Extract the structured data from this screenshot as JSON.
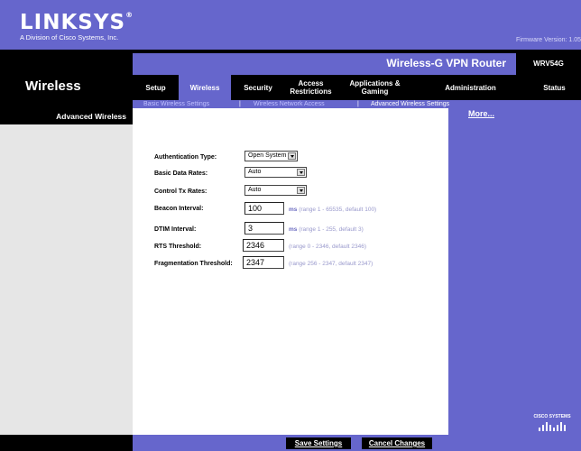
{
  "header": {
    "logo": "LINKSYS",
    "logo_mark": "®",
    "logo_subtitle": "A Division of Cisco Systems, Inc.",
    "firmware": "Firmware Version: 1.05"
  },
  "product": {
    "name": "Wireless-G VPN Router",
    "model": "WRV54G"
  },
  "section_title": "Wireless",
  "tabs": [
    {
      "label": "Setup"
    },
    {
      "label": "Wireless",
      "active": true
    },
    {
      "label": "Security"
    },
    {
      "label": "Access Restrictions"
    },
    {
      "label": "Applications & Gaming"
    },
    {
      "label": "Administration"
    },
    {
      "label": "Status"
    }
  ],
  "subnav": {
    "items": [
      "Basic Wireless Settings",
      "Wireless Network Access",
      "Advanced Wireless Settings"
    ],
    "active": "Advanced Wireless Settings",
    "separator": "|"
  },
  "left_heading": "Advanced Wireless",
  "right": {
    "more_link": "More...",
    "cisco_logo": "CISCO SYSTEMS"
  },
  "form": {
    "auth_type": {
      "label": "Authentication Type:",
      "value": "Open System"
    },
    "basic_rates": {
      "label": "Basic Data Rates:",
      "value": "Auto"
    },
    "control_tx": {
      "label": "Control Tx Rates:",
      "value": "Auto"
    },
    "beacon": {
      "label": "Beacon Interval:",
      "value": "100",
      "unit": "ms",
      "hint": "(range 1 - 65535, default 100)"
    },
    "dtim": {
      "label": "DTIM Interval:",
      "value": "3",
      "unit": "ms",
      "hint": "(range 1 - 255, default 3)"
    },
    "rts": {
      "label": "RTS Threshold:",
      "value": "2346",
      "hint": "(range 0 - 2346, default 2346)"
    },
    "frag": {
      "label": "Fragmentation Threshold:",
      "value": "2347",
      "hint": "(range 256 - 2347, default 2347)"
    }
  },
  "buttons": {
    "save": "Save Settings",
    "cancel": "Cancel Changes"
  },
  "colors": {
    "brand": "#6666cc",
    "dark": "#000000",
    "side": "#e6e6e6"
  }
}
